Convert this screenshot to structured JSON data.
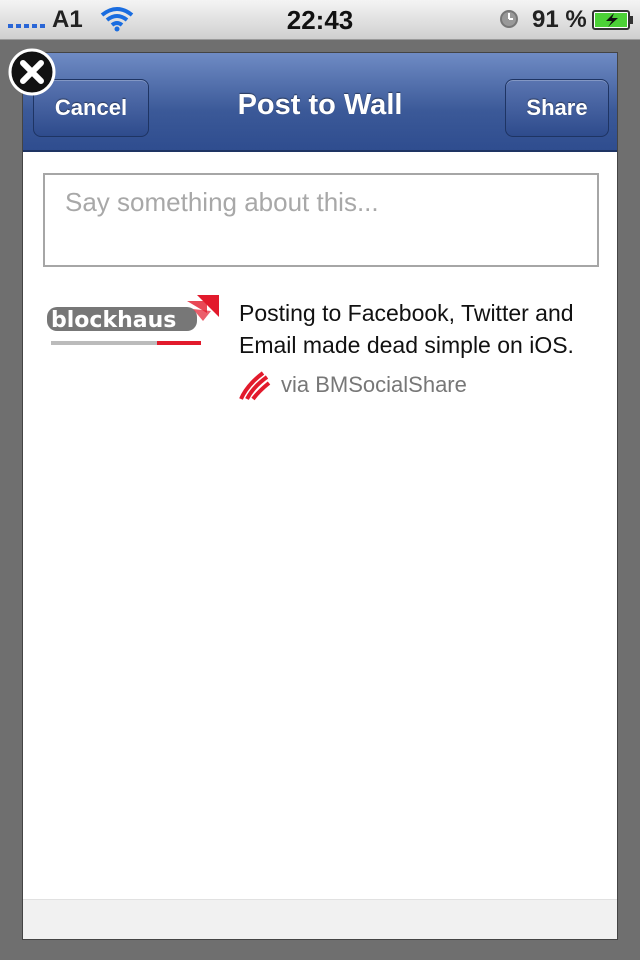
{
  "status_bar": {
    "carrier": "A1",
    "time": "22:43",
    "battery_percent": "91 %",
    "icons": [
      "signal-icon",
      "wifi-icon",
      "alarm-icon",
      "battery-icon"
    ]
  },
  "dialog": {
    "title": "Post to Wall",
    "cancel_label": "Cancel",
    "share_label": "Share",
    "comment_placeholder": "Say something about this...",
    "close_icon": "close-icon"
  },
  "share_item": {
    "logo_icon": "blockhaus-logo",
    "text": "Posting to Facebook, Twitter and Email made dead simple on iOS.",
    "via_text": "via BMSocialShare",
    "via_icon": "blockhaus-mark-icon"
  },
  "colors": {
    "facebook_blue": "#3b5998",
    "brand_red": "#e21a2c",
    "backdrop": "#6f6f6f"
  }
}
